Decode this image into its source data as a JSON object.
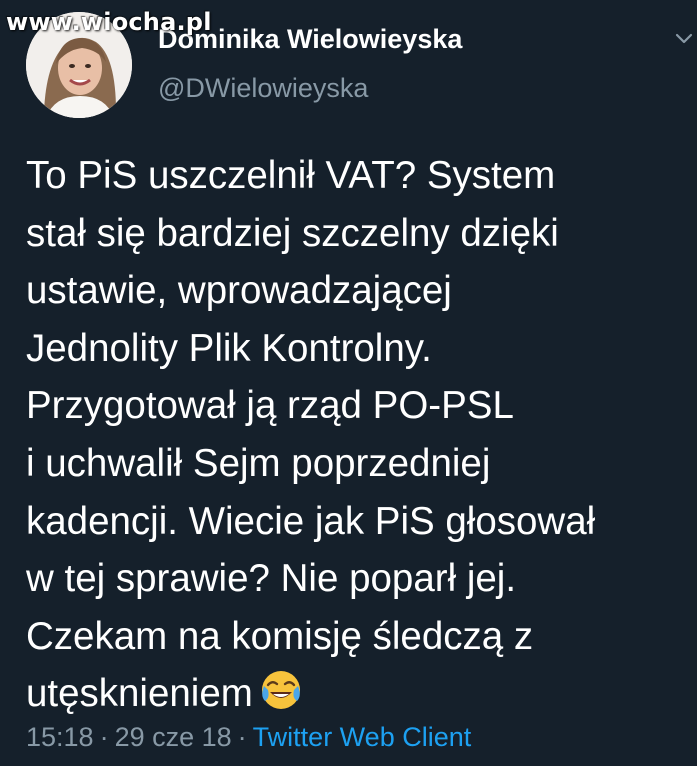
{
  "watermark": "www.wiocha.pl",
  "author": {
    "display_name": "Dominika Wielowieyska",
    "handle": "@DWielowieyska"
  },
  "tweet": {
    "lines": [
      "To PiS uszczelnił VAT? System",
      "stał się bardziej szczelny dzięki",
      "ustawie, wprowadzającej",
      "Jednolity Plik Kontrolny.",
      "Przygotował ją rząd PO-PSL",
      "i uchwalił Sejm poprzedniej",
      "kadencji. Wiecie jak PiS głosował",
      "w tej sprawie? Nie poparł jej.",
      "Czekam na komisję śledczą z",
      "utęsknieniem"
    ],
    "emoji": "face-with-tears-of-joy"
  },
  "meta": {
    "time": "15:18",
    "date": "29 cze 18",
    "separator": "·",
    "client": "Twitter Web Client"
  },
  "icons": {
    "menu": "chevron-down-icon",
    "emoji": "face-with-tears-of-joy-icon"
  },
  "colors": {
    "background": "#15202b",
    "text": "#ffffff",
    "secondary": "#8899a6",
    "link": "#1da1f2"
  }
}
